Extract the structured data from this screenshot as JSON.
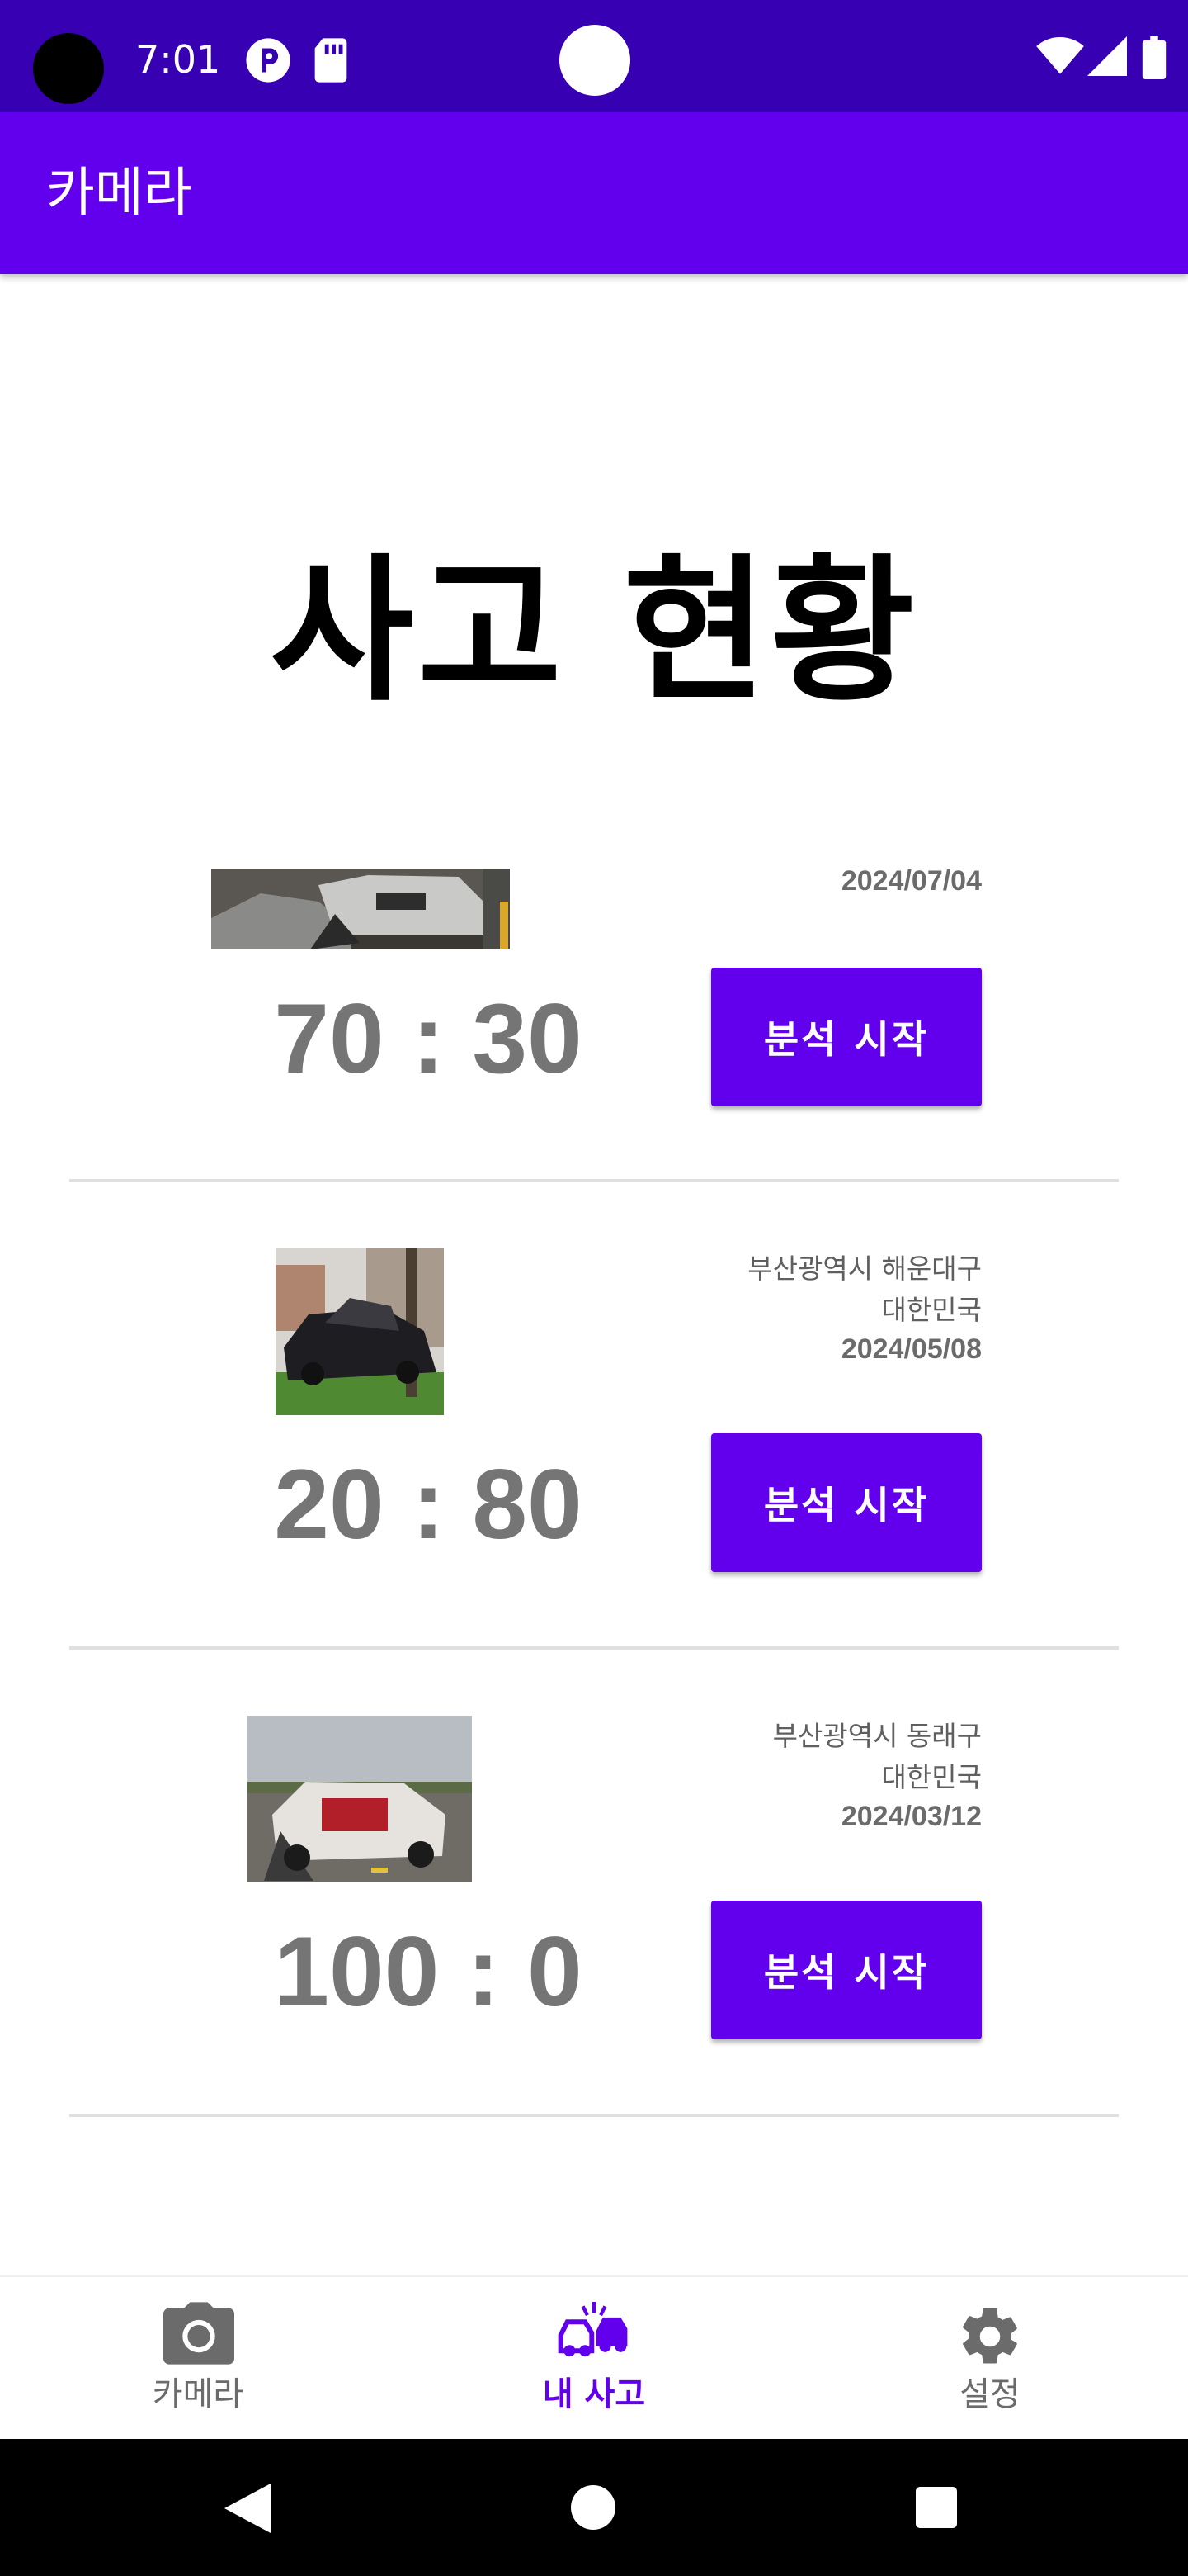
{
  "status_bar": {
    "time": "7:01"
  },
  "app_bar": {
    "title": "카메라"
  },
  "page": {
    "heading": "사고 현황"
  },
  "accidents": [
    {
      "location": "",
      "country": "",
      "date": "2024/07/04",
      "ratio": "70 : 30",
      "button_label": "분석 시작"
    },
    {
      "location": "부산광역시 해운대구",
      "country": "대한민국",
      "date": "2024/05/08",
      "ratio": "20 : 80",
      "button_label": "분석 시작"
    },
    {
      "location": "부산광역시 동래구",
      "country": "대한민국",
      "date": "2024/03/12",
      "ratio": "100 : 0",
      "button_label": "분석 시작"
    }
  ],
  "bottom_nav": {
    "items": [
      {
        "label": "카메라",
        "icon": "camera-icon",
        "active": false
      },
      {
        "label": "내 사고",
        "icon": "car-crash-icon",
        "active": true
      },
      {
        "label": "설정",
        "icon": "gear-icon",
        "active": false
      }
    ]
  },
  "colors": {
    "primary": "#6200ee",
    "primary_dark": "#3700b3",
    "ratio_text": "#757575"
  }
}
